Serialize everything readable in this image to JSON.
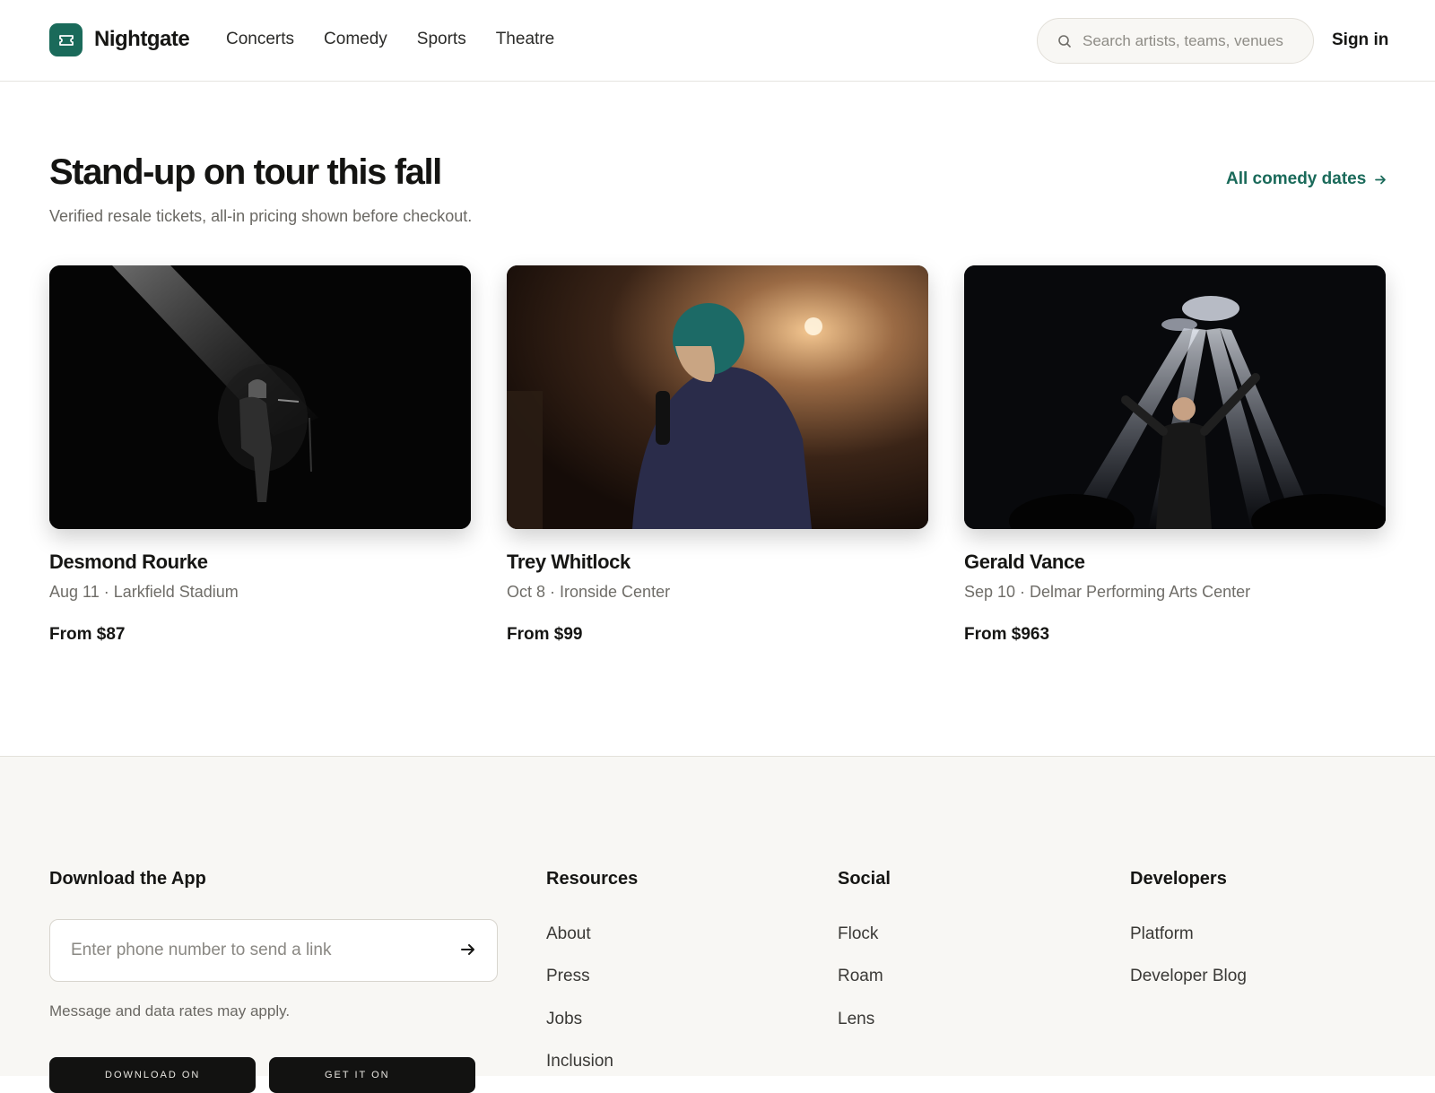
{
  "header": {
    "brand": "Nightgate",
    "nav": [
      "Concerts",
      "Comedy",
      "Sports",
      "Theatre"
    ],
    "search_placeholder": "Search artists, teams, venues",
    "signin": "Sign in"
  },
  "section": {
    "title": "Stand-up on tour this fall",
    "subtitle": "Verified resale tickets, all-in pricing shown before checkout.",
    "link": "All comedy dates"
  },
  "cards": [
    {
      "name": "Desmond Rourke",
      "meta": "Aug 11 · Larkfield Stadium",
      "price": "From $87"
    },
    {
      "name": "Trey Whitlock",
      "meta": "Oct 8 · Ironside Center",
      "price": "From $99"
    },
    {
      "name": "Gerald Vance",
      "meta": "Sep 10 · Delmar Performing Arts Center",
      "price": "From $963"
    }
  ],
  "footer": {
    "app_title": "Download the App",
    "phone_placeholder": "Enter phone number to send a link",
    "rates_note": "Message and data rates may apply.",
    "store_buttons": [
      "DOWNLOAD ON",
      "GET IT ON"
    ],
    "columns": [
      {
        "title": "Resources",
        "links": [
          "About",
          "Press",
          "Jobs",
          "Inclusion"
        ]
      },
      {
        "title": "Social",
        "links": [
          "Flock",
          "Roam",
          "Lens"
        ]
      },
      {
        "title": "Developers",
        "links": [
          "Platform",
          "Developer Blog"
        ]
      }
    ]
  },
  "colors": {
    "brand": "#1a6a5a",
    "text": "#161614",
    "muted": "#6f6d68",
    "footer_bg": "#f8f7f4"
  }
}
